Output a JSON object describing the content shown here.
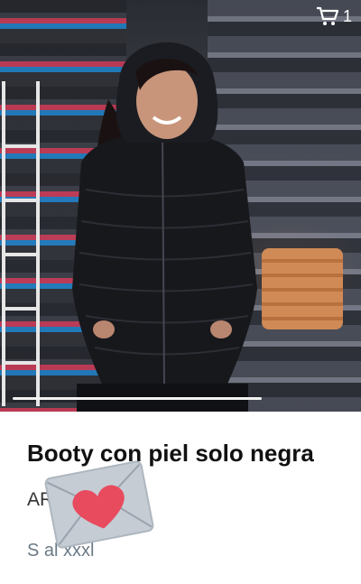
{
  "header": {
    "cart_icon": "cart-icon",
    "cart_count": "1"
  },
  "product": {
    "image_alt": "Woman wearing black hooded puffer jacket",
    "title": "Booty con piel solo negra",
    "price": "AR$ 7.500",
    "sizes": "S al xxxl"
  },
  "overlay": {
    "icon": "heart-envelope-icon"
  },
  "colors": {
    "heart": "#e84b5e",
    "envelope": "#c5ccd4",
    "title": "#111111",
    "subtitle": "#6b7a86"
  }
}
